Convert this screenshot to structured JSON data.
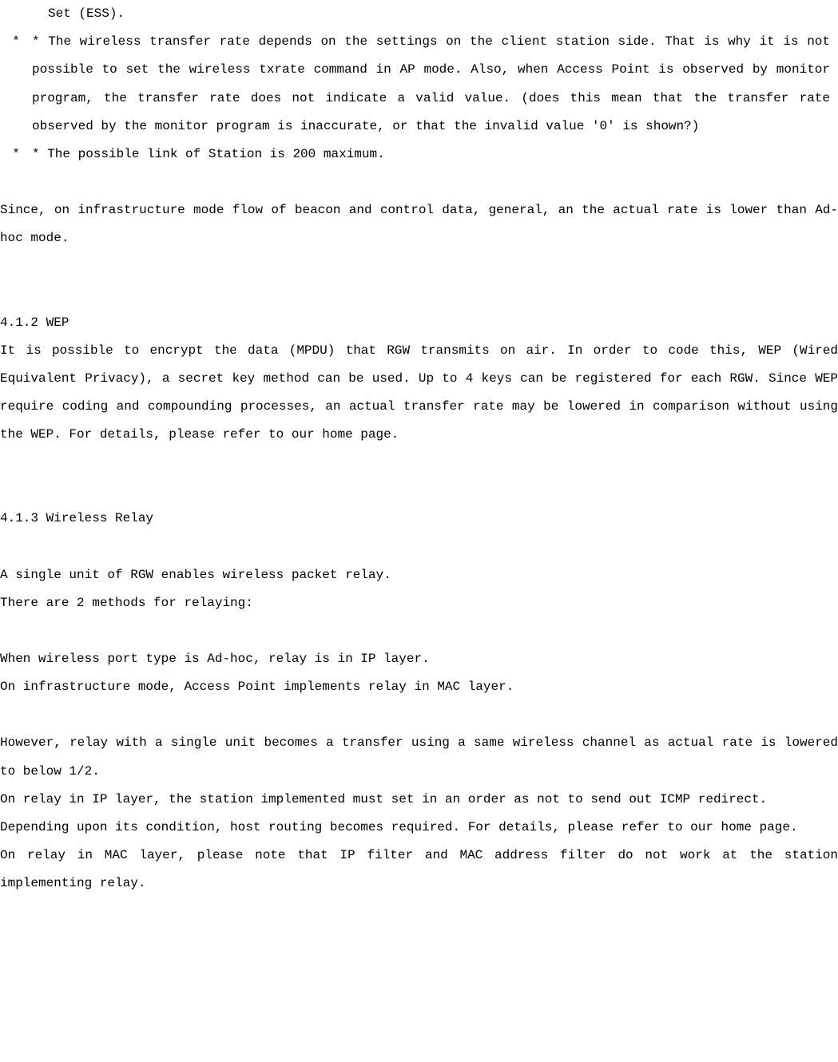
{
  "bullets": {
    "item0_fragment": "Set (ESS).",
    "item1_marker": "*",
    "item1_text": "* The wireless transfer rate depends on the settings on the client station side. That is why it is not possible to set the wireless txrate command in AP mode. Also, when Access Point is observed by monitor program, the transfer rate does not indicate a valid value. (does this mean that the transfer rate observed by the monitor program is inaccurate, or that the invalid value '0' is shown?)",
    "item2_marker": "*",
    "item2_text": " * The possible link of Station is 200 maximum."
  },
  "para1": "Since, on infrastructure mode  flow of beacon and control data, general, an the actual rate is lower than Ad-hoc mode.",
  "section_wep": {
    "heading": "4.1.2 WEP",
    "body": "It is possible to encrypt the data (MPDU) that RGW transmits on air. In order to code this,  WEP (Wired Equivalent Privacy), a  secret key method can be used. Up to 4 keys can be registered for each RGW. Since WEP require coding and compounding processes, an actual transfer rate may be lowered in comparison without using the WEP. For details, please refer to our home page."
  },
  "section_relay": {
    "heading": "4.1.3 Wireless Relay",
    "intro1": "A single unit of RGW enables wireless packet relay.",
    "intro2": "There are 2 methods for relaying:",
    "method1": "When wireless port type is Ad-hoc, relay is in IP layer.",
    "method2": "On infrastructure mode, Access Point implements relay in MAC layer.",
    "note1": "However, relay with a single unit becomes a transfer using a same wireless channel as actual rate is lowered to below 1/2.",
    "note2": "On relay in IP layer, the station implemented must set in an order as not to send out ICMP redirect.",
    "note3": "Depending upon its condition, host routing becomes required. For details, please refer to our home page.",
    "note4": "On relay in MAC layer, please note that IP filter and MAC address filter do not work at the station implementing relay."
  }
}
